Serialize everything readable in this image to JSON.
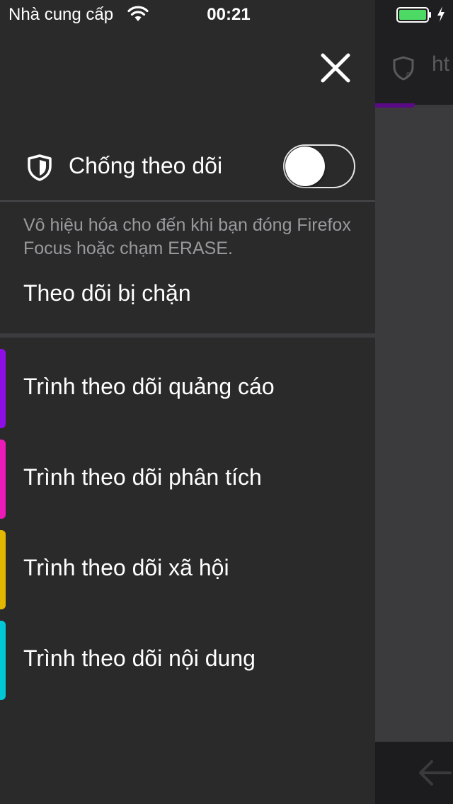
{
  "status_bar": {
    "carrier": "Nhà cung cấp",
    "time": "00:21",
    "wifi_icon": "wifi-icon",
    "battery_icon": "battery-icon",
    "charging_icon": "charging-bolt-icon",
    "battery_color": "#4cd964"
  },
  "background_browser": {
    "url_fragment": "ht",
    "shield_icon": "shield-icon",
    "back_icon": "back-arrow-icon",
    "progress_color": "#5b0a86"
  },
  "panel": {
    "close_icon": "close-icon",
    "tracking_protection": {
      "label": "Chống theo dõi",
      "icon": "shield-icon",
      "enabled": false,
      "description": "Vô hiệu hóa cho đến khi bạn đóng Firefox Focus hoặc chạm ERASE."
    },
    "blocked_section_title": "Theo dõi bị chặn",
    "trackers": [
      {
        "label": "Trình theo dõi quảng cáo",
        "color": "#8f0ee6"
      },
      {
        "label": "Trình theo dõi phân tích",
        "color": "#ec1ab6"
      },
      {
        "label": "Trình theo dõi xã hội",
        "color": "#e3b600"
      },
      {
        "label": "Trình theo dõi nội dung",
        "color": "#00c8d7"
      }
    ]
  }
}
